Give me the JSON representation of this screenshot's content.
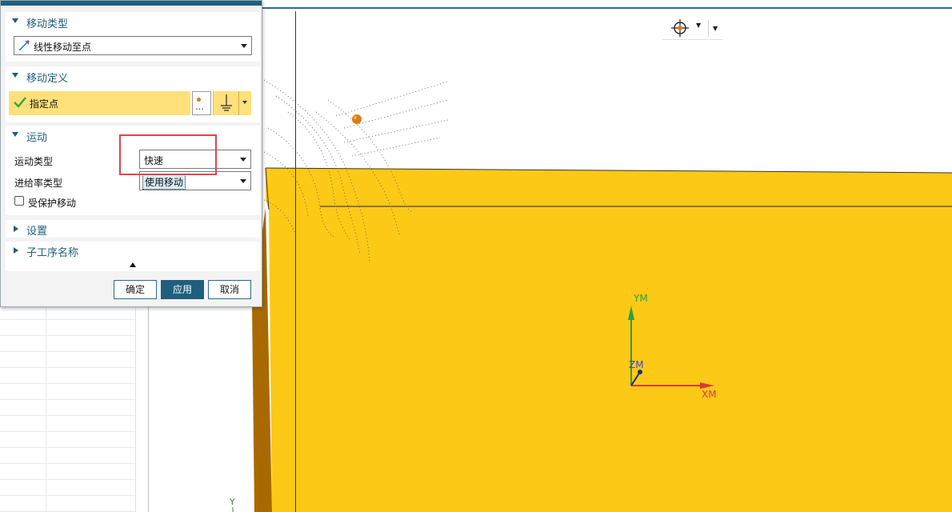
{
  "dialog": {
    "sections": {
      "move_type": {
        "title": "移动类型",
        "combo_value": "线性移动至点"
      },
      "move_def": {
        "title": "移动定义",
        "point_label": "指定点"
      },
      "motion": {
        "title": "运动",
        "motion_type_label": "运动类型",
        "motion_type_value": "快速",
        "feed_type_label": "进给率类型",
        "feed_type_value": "使用移动",
        "protect_label": "受保护移动"
      },
      "settings": {
        "title": "设置"
      },
      "suboperation_name": {
        "title": "子工序名称"
      }
    },
    "buttons": {
      "ok": "确定",
      "apply": "应用",
      "cancel": "取消"
    }
  },
  "viewport": {
    "axes": {
      "y": "YM",
      "z": "ZM",
      "x": "XM",
      "wcs_y": "Y"
    },
    "colors": {
      "stock": "#fcc916",
      "stock_side": "#a86a00",
      "accent": "#1f5f7d",
      "highlight": "#e0444e",
      "y_axis": "#2f9e3f",
      "x_axis": "#d93b3b",
      "z_axis": "#1b2a8c",
      "point": "#e07b12"
    }
  }
}
